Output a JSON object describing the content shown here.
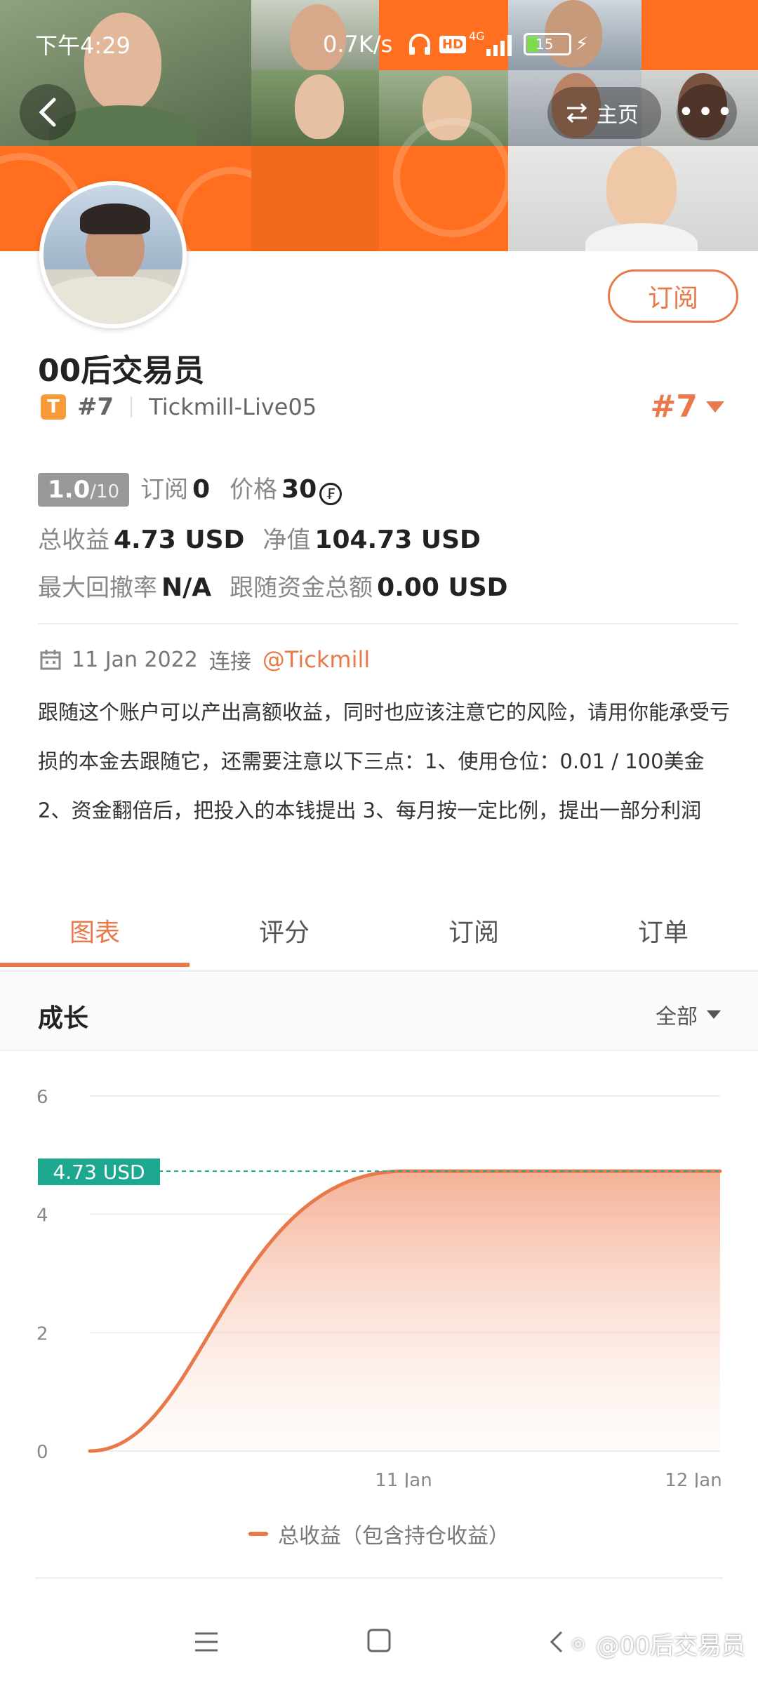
{
  "status_bar": {
    "time": "下午4:29",
    "net_speed": "0.7K/s",
    "signal": "4G",
    "battery": "15"
  },
  "header": {
    "home_label": "主页"
  },
  "profile": {
    "name": "00后交易员",
    "subscribe_label": "订阅",
    "badge_letter": "T",
    "rank": "#7",
    "account": "Tickmill-Live05",
    "rank_right": "#7"
  },
  "stats": {
    "score": "1.0",
    "score_max": "/10",
    "subscribe_label": "订阅",
    "subscribe_value": "0",
    "price_label": "价格",
    "price_value": "30",
    "total_profit_label": "总收益",
    "total_profit_value": "4.73 USD",
    "equity_label": "净值",
    "equity_value": "104.73 USD",
    "max_drawdown_label": "最大回撤率",
    "max_drawdown_value": "N/A",
    "follow_funds_label": "跟随资金总额",
    "follow_funds_value": "0.00 USD"
  },
  "description": {
    "date": "11 Jan 2022",
    "connect_label": "连接",
    "broker": "@Tickmill",
    "text": "跟随这个账户可以产出高额收益，同时也应该注意它的风险，请用你能承受亏损的本金去跟随它，还需要注意以下三点：1、使用仓位：0.01 / 100美金 2、资金翻倍后，把投入的本钱提出 3、每月按一定比例，提出一部分利润"
  },
  "tabs": [
    {
      "label": "图表"
    },
    {
      "label": "评分"
    },
    {
      "label": "订阅"
    },
    {
      "label": "订单"
    }
  ],
  "section": {
    "title": "成长",
    "filter": "全部"
  },
  "chart_data": {
    "type": "area",
    "title": "",
    "xlabel": "",
    "ylabel": "",
    "ylim": [
      0,
      6
    ],
    "yticks": [
      "6",
      "4",
      "2",
      "0"
    ],
    "xticks": [
      "11 Jan",
      "12 Jan"
    ],
    "grid": true,
    "current_label": "4.73 USD",
    "series": [
      {
        "name": "总收益（包含持仓收益）",
        "color": "#e8794a",
        "x": [
          "10 Jan",
          "11 Jan",
          "12 Jan"
        ],
        "values": [
          0,
          4.73,
          4.73
        ]
      }
    ]
  },
  "legend": {
    "label": "总收益（包含持仓收益）"
  },
  "watermark": "@00后交易员",
  "colors": {
    "accent": "#e8794a",
    "teal": "#1fa890",
    "banner_orange": "#ff6f1f"
  }
}
